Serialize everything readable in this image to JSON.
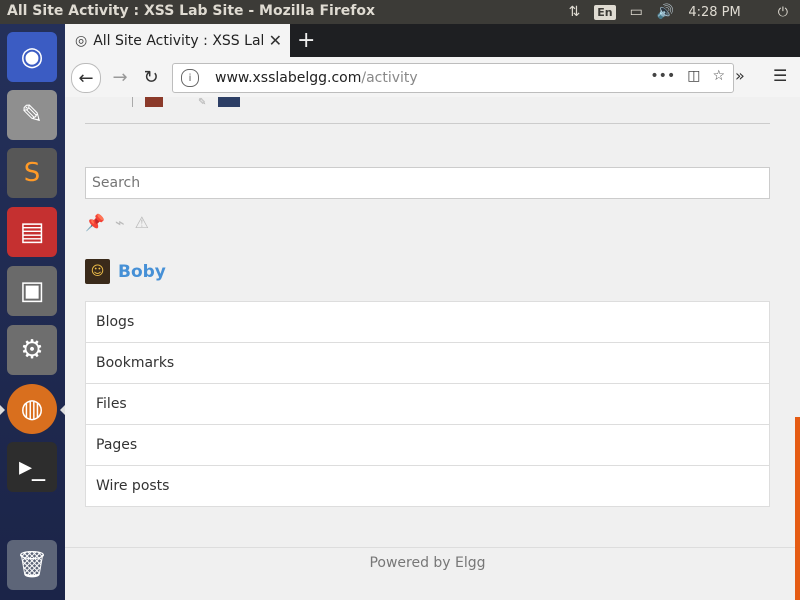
{
  "system": {
    "window_title": "All Site Activity : XSS Lab Site - Mozilla Firefox",
    "lang": "En",
    "clock": "4:28 PM"
  },
  "browser": {
    "tab_title": "All Site Activity : XSS Lab Site",
    "new_tab_symbol": "+",
    "url_domain": "www.xsslabelgg.com",
    "url_path": "/activity"
  },
  "page": {
    "search_placeholder": "Search",
    "owner_name": "Boby",
    "menu_items": [
      "Blogs",
      "Bookmarks",
      "Files",
      "Pages",
      "Wire posts"
    ],
    "footer": "Powered by Elgg"
  }
}
